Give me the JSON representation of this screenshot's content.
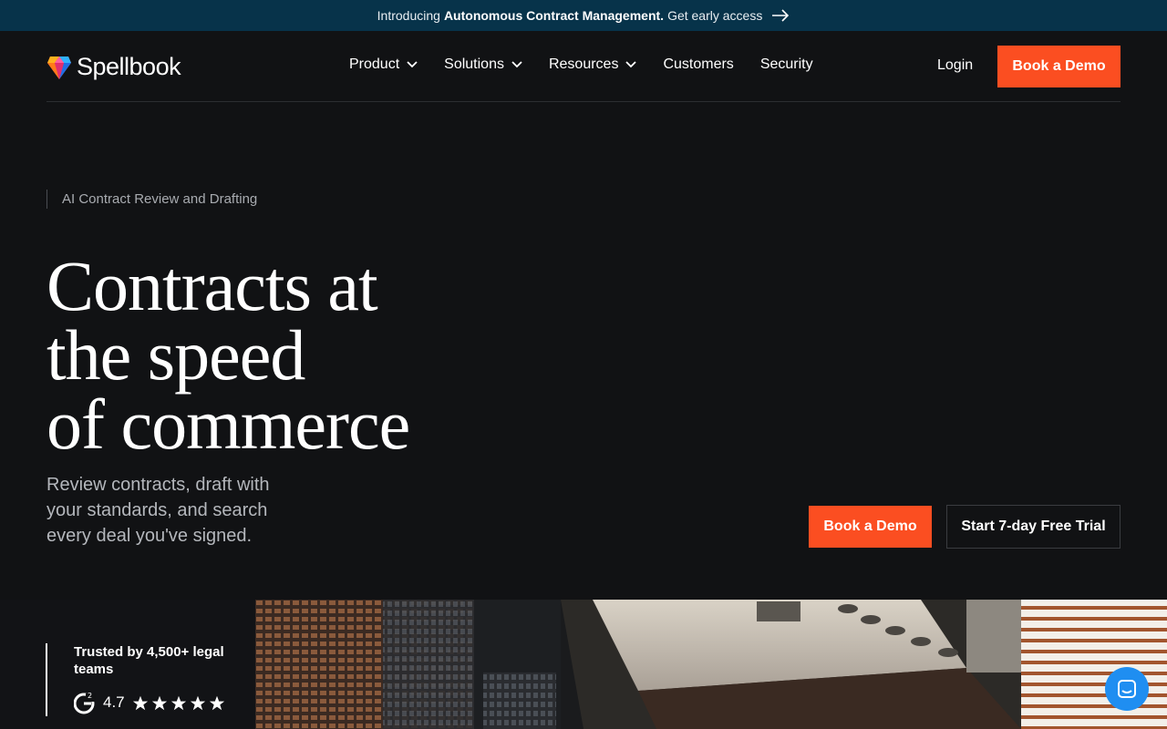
{
  "announcement": {
    "intro": "Introducing",
    "highlight": "Autonomous Contract Management.",
    "link": "Get early access",
    "arrow_icon": "arrow-right-icon"
  },
  "nav": {
    "logo_text": "Spellbook",
    "items": [
      {
        "label": "Product",
        "dropdown": true
      },
      {
        "label": "Solutions",
        "dropdown": true
      },
      {
        "label": "Resources",
        "dropdown": true
      },
      {
        "label": "Customers",
        "dropdown": false
      },
      {
        "label": "Security",
        "dropdown": false
      }
    ],
    "login": "Login",
    "book_demo": "Book a Demo"
  },
  "hero": {
    "eyebrow": "AI Contract Review and Drafting",
    "title_lines": [
      "Contracts at",
      "the speed",
      "of commerce"
    ],
    "subtitle": "Review contracts, draft with your standards, and search every deal you've signed.",
    "cta_demo": "Book a Demo",
    "cta_trial": "Start 7-day Free Trial"
  },
  "trust": {
    "text": "Trusted by 4,500+ legal teams",
    "rating": "4.7",
    "stars": 5,
    "g2_icon": "g2-logo-icon"
  },
  "colors": {
    "accent": "#fb4e21",
    "announcement_bg": "#07334a",
    "background": "#111214",
    "chat": "#1f8ef1"
  }
}
